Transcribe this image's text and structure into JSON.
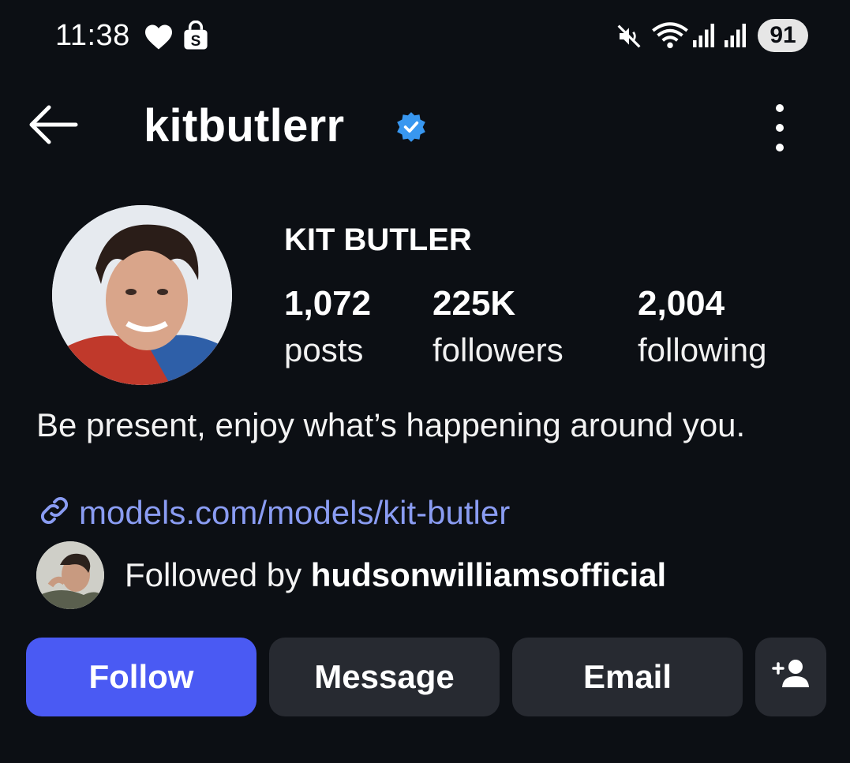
{
  "status_bar": {
    "time": "11:38",
    "battery": "91",
    "icons": [
      "heart-icon",
      "shopping-bag-icon",
      "mute-icon",
      "wifi-icon",
      "signal-icon",
      "signal-icon"
    ]
  },
  "header": {
    "username": "kitbutlerr",
    "verified": true,
    "back_icon": "back-arrow-icon",
    "more_icon": "more-vertical-icon"
  },
  "profile": {
    "full_name": "KIT BUTLER",
    "stats": [
      {
        "value": "1,072",
        "label": "posts"
      },
      {
        "value": "225K",
        "label": "followers"
      },
      {
        "value": "2,004",
        "label": "following"
      }
    ],
    "bio": "Be present, enjoy what’s happening around you.",
    "link": "models.com/models/kit-butler",
    "followed_by_prefix": "Followed by ",
    "followed_by_user": "hudsonwilliamsofficial"
  },
  "actions": {
    "follow": "Follow",
    "message": "Message",
    "email": "Email",
    "add_person_icon": "add-person-icon"
  },
  "colors": {
    "background": "#0c0f14",
    "follow_button": "#4a5af3",
    "secondary_button": "#272a31",
    "link": "#8a9cf2",
    "verified_badge": "#3897f0"
  }
}
